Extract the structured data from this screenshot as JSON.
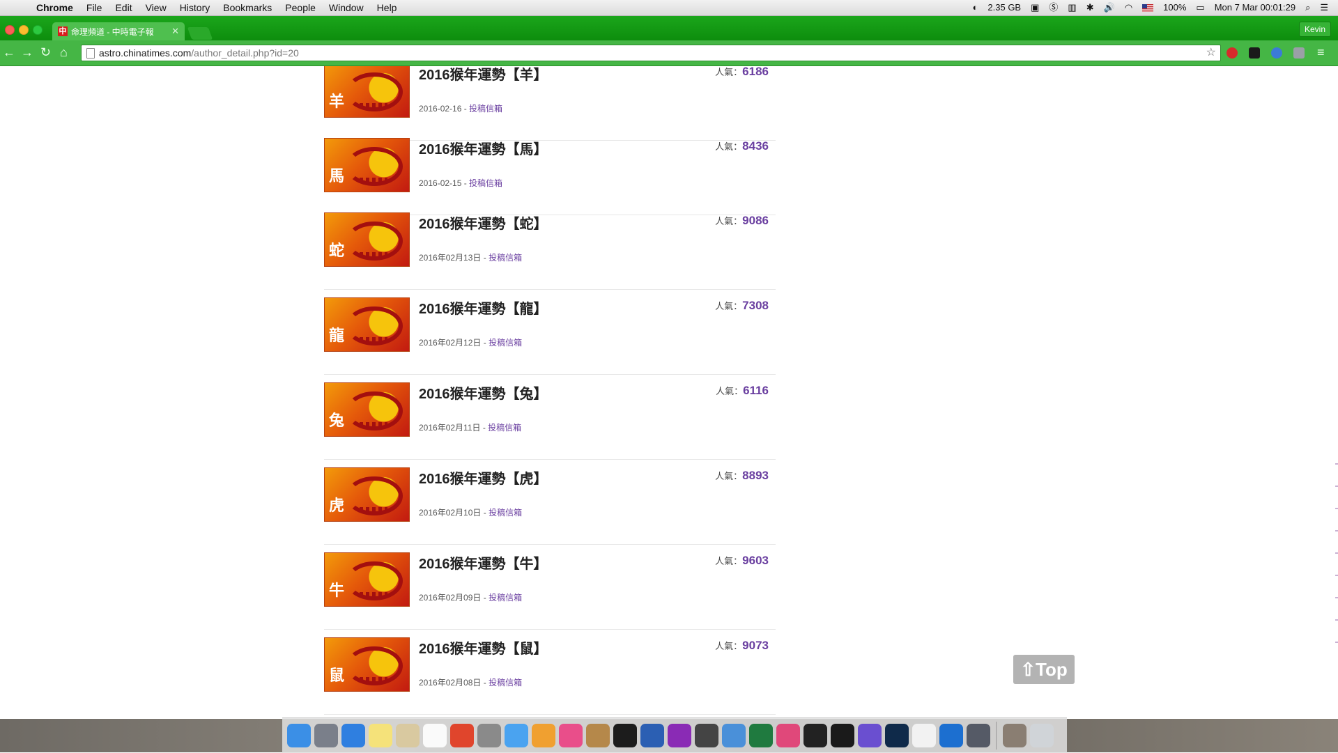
{
  "menubar": {
    "app_name": "Chrome",
    "menus": [
      "File",
      "Edit",
      "View",
      "History",
      "Bookmarks",
      "People",
      "Window",
      "Help"
    ],
    "memory": "2.35 GB",
    "battery": "100%",
    "clock": "Mon 7 Mar  00:01:29"
  },
  "browser": {
    "tab_title": "命理頻道 - 中時電子報",
    "profile_name": "Kevin",
    "url_host": "astro.chinatimes.com",
    "url_path": "/author_detail.php?id=20",
    "theme_color": "#1ba61b"
  },
  "page": {
    "popularity_label": "人氣：",
    "author_link": "投稿信箱",
    "top_button": "Top",
    "articles": [
      {
        "title": "2016猴年運勢【羊】",
        "zodiac": "羊",
        "views": "6186",
        "date": "2016-02-16 - "
      },
      {
        "title": "2016猴年運勢【馬】",
        "zodiac": "馬",
        "views": "8436",
        "date": "2016-02-15 - "
      },
      {
        "title": "2016猴年運勢【蛇】",
        "zodiac": "蛇",
        "views": "9086",
        "date": "2016年02月13日 - "
      },
      {
        "title": "2016猴年運勢【龍】",
        "zodiac": "龍",
        "views": "7308",
        "date": "2016年02月12日 - "
      },
      {
        "title": "2016猴年運勢【兔】",
        "zodiac": "兔",
        "views": "6116",
        "date": "2016年02月11日 - "
      },
      {
        "title": "2016猴年運勢【虎】",
        "zodiac": "虎",
        "views": "8893",
        "date": "2016年02月10日 - "
      },
      {
        "title": "2016猴年運勢【牛】",
        "zodiac": "牛",
        "views": "9603",
        "date": "2016年02月09日 - "
      },
      {
        "title": "2016猴年運勢【鼠】",
        "zodiac": "鼠",
        "views": "9073",
        "date": "2016年02月08日 - "
      }
    ]
  },
  "dock": {
    "icons": [
      {
        "name": "finder-icon",
        "color": "#3b8fe6"
      },
      {
        "name": "launchpad-icon",
        "color": "#7a7f8a"
      },
      {
        "name": "safari-icon",
        "color": "#2f7fe0"
      },
      {
        "name": "notes-icon",
        "color": "#f5e27a"
      },
      {
        "name": "preview-icon",
        "color": "#d9c9a0"
      },
      {
        "name": "calendar-icon",
        "color": "#fafafa"
      },
      {
        "name": "chrome-icon",
        "color": "#e0452c"
      },
      {
        "name": "archive-icon",
        "color": "#8a8a8a"
      },
      {
        "name": "messages-icon",
        "color": "#4aa3f0"
      },
      {
        "name": "photos-icon",
        "color": "#f0a030"
      },
      {
        "name": "itunes-icon",
        "color": "#e94e8a"
      },
      {
        "name": "ibooks-icon",
        "color": "#b5884a"
      },
      {
        "name": "gopro-icon",
        "color": "#1c1c1c"
      },
      {
        "name": "word-icon",
        "color": "#2b5fb3"
      },
      {
        "name": "podcast-icon",
        "color": "#8a2bb5"
      },
      {
        "name": "final-cut-icon",
        "color": "#444444"
      },
      {
        "name": "xcode-icon",
        "color": "#4a90d9"
      },
      {
        "name": "excel-icon",
        "color": "#1f7a3f"
      },
      {
        "name": "keynote-icon",
        "color": "#e0487a"
      },
      {
        "name": "terminal-icon",
        "color": "#222222"
      },
      {
        "name": "activity-monitor-icon",
        "color": "#1a1a1a"
      },
      {
        "name": "imovie-icon",
        "color": "#6a4fd0"
      },
      {
        "name": "photoshop-icon",
        "color": "#0f2a4a"
      },
      {
        "name": "textedit-icon",
        "color": "#f2f2f2"
      },
      {
        "name": "teamviewer-icon",
        "color": "#1c6fd0"
      },
      {
        "name": "screen-sharing-icon",
        "color": "#555a66"
      },
      {
        "name": "downloads-stack-icon",
        "color": "#8a7e72"
      },
      {
        "name": "trash-icon",
        "color": "#d0d4d8"
      }
    ]
  }
}
